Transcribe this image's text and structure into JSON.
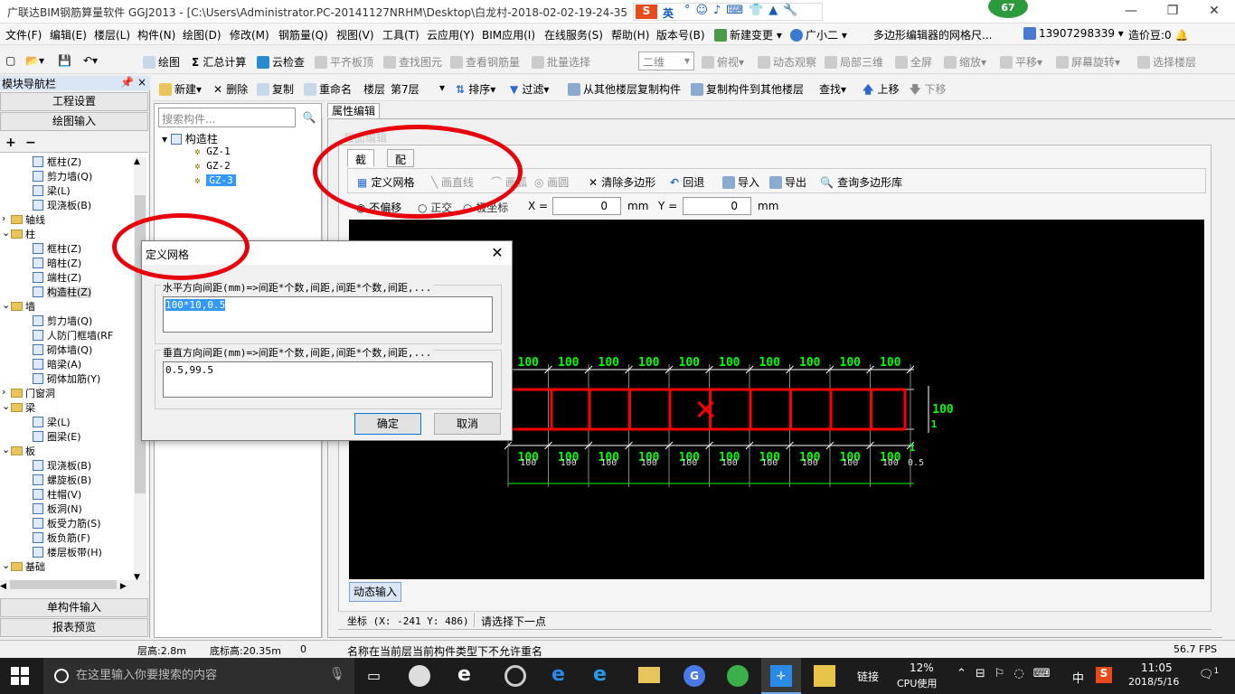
{
  "window": {
    "title": "广联达BIM钢筋算量软件 GGJ2013 - [C:\\Users\\Administrator.PC-20141127NRHM\\Desktop\\白龙村-2018-02-02-19-24-35",
    "badge": "67",
    "ime": "英"
  },
  "menu": [
    "文件(F)",
    "编辑(E)",
    "楼层(L)",
    "构件(N)",
    "绘图(D)",
    "修改(M)",
    "钢筋量(Q)",
    "视图(V)",
    "工具(T)",
    "云应用(Y)",
    "BIM应用(I)",
    "在线服务(S)",
    "帮助(H)",
    "版本号(B)",
    "新建变更",
    "广小二"
  ],
  "menu_right": {
    "hint": "多边形编辑器的网格尺...",
    "phone": "13907298339",
    "price": "造价豆:0"
  },
  "toolbar": {
    "items": [
      "绘图",
      "汇总计算",
      "云检查",
      "平齐板顶",
      "查找图元",
      "查看钢筋量",
      "批量选择"
    ],
    "view_mode": "二维",
    "right_items": [
      "俯视",
      "动态观察",
      "局部三维",
      "全屏",
      "缩放",
      "平移",
      "屏幕旋转",
      "选择楼层"
    ]
  },
  "secondary_toolbar": {
    "items": [
      "新建",
      "删除",
      "复制",
      "重命名",
      "楼层"
    ],
    "floor": "第7层",
    "more": [
      "排序",
      "过滤",
      "从其他楼层复制构件",
      "复制构件到其他楼层",
      "查找",
      "上移",
      "下移"
    ]
  },
  "left_panel": {
    "header": "模块导航栏",
    "buttons": [
      "工程设置",
      "绘图输入"
    ],
    "tree": [
      {
        "label": "框柱(Z)",
        "indent": 3,
        "type": "leaf"
      },
      {
        "label": "剪力墙(Q)",
        "indent": 3,
        "type": "leaf"
      },
      {
        "label": "梁(L)",
        "indent": 3,
        "type": "leaf"
      },
      {
        "label": "现浇板(B)",
        "indent": 3,
        "type": "leaf"
      },
      {
        "label": "轴线",
        "indent": 1,
        "type": "folder"
      },
      {
        "label": "柱",
        "indent": 1,
        "type": "folder"
      },
      {
        "label": "框柱(Z)",
        "indent": 3,
        "type": "leaf"
      },
      {
        "label": "暗柱(Z)",
        "indent": 3,
        "type": "leaf"
      },
      {
        "label": "端柱(Z)",
        "indent": 3,
        "type": "leaf"
      },
      {
        "label": "构造柱(Z)",
        "indent": 3,
        "type": "leaf"
      },
      {
        "label": "墙",
        "indent": 1,
        "type": "folder"
      },
      {
        "label": "剪力墙(Q)",
        "indent": 3,
        "type": "leaf"
      },
      {
        "label": "人防门框墙(RF",
        "indent": 3,
        "type": "leaf"
      },
      {
        "label": "砌体墙(Q)",
        "indent": 3,
        "type": "leaf"
      },
      {
        "label": "暗梁(A)",
        "indent": 3,
        "type": "leaf"
      },
      {
        "label": "砌体加筋(Y)",
        "indent": 3,
        "type": "leaf"
      },
      {
        "label": "门窗洞",
        "indent": 1,
        "type": "folder"
      },
      {
        "label": "梁",
        "indent": 1,
        "type": "folder"
      },
      {
        "label": "梁(L)",
        "indent": 3,
        "type": "leaf"
      },
      {
        "label": "圈梁(E)",
        "indent": 3,
        "type": "leaf"
      },
      {
        "label": "板",
        "indent": 1,
        "type": "folder"
      },
      {
        "label": "现浇板(B)",
        "indent": 3,
        "type": "leaf"
      },
      {
        "label": "螺旋板(B)",
        "indent": 3,
        "type": "leaf"
      },
      {
        "label": "柱帽(V)",
        "indent": 3,
        "type": "leaf"
      },
      {
        "label": "板洞(N)",
        "indent": 3,
        "type": "leaf"
      },
      {
        "label": "板受力筋(S)",
        "indent": 3,
        "type": "leaf"
      },
      {
        "label": "板负筋(F)",
        "indent": 3,
        "type": "leaf"
      },
      {
        "label": "楼层板带(H)",
        "indent": 3,
        "type": "leaf"
      },
      {
        "label": "基础",
        "indent": 1,
        "type": "folder"
      }
    ],
    "bottom_buttons": [
      "单构件输入",
      "报表预览"
    ]
  },
  "component_list": {
    "search_placeholder": "搜索构件...",
    "root": "构造柱",
    "items": [
      "GZ-1",
      "GZ-2",
      "GZ-3"
    ],
    "selected": "GZ-3"
  },
  "editor": {
    "prop_tab": "属性编辑",
    "faded_title": "截面编辑",
    "tabs": [
      "截面",
      "配筋"
    ],
    "tools": [
      "定义网格",
      "画直线",
      "画弧",
      "画圆",
      "清除多边形",
      "回退",
      "导入",
      "导出",
      "查询多边形库"
    ],
    "coord": {
      "options": [
        "不偏移",
        "正交",
        "极坐标"
      ],
      "x_label": "X =",
      "x_value": "0",
      "y_label": "Y =",
      "y_value": "0",
      "unit": "mm"
    },
    "dynamic_input": "动态输入",
    "coord_text": "坐标 (X: -241 Y: 486)",
    "prompt": "请选择下一点"
  },
  "canvas": {
    "top_dims": [
      "100",
      "100",
      "100",
      "100",
      "100",
      "100",
      "100",
      "100",
      "100",
      "100"
    ],
    "bottom_dims_green": [
      "100",
      "100",
      "100",
      "100",
      "100",
      "100",
      "100",
      "100",
      "100",
      "100"
    ],
    "bottom_dims_white": [
      "100",
      "100",
      "100",
      "100",
      "100",
      "100",
      "100",
      "100",
      "100",
      "100",
      "0.5"
    ],
    "right_dim": "100",
    "right_sub": "1",
    "bottom_sub": "1"
  },
  "dialog": {
    "title": "定义网格",
    "h_label": "水平方向间距(mm)=>间距*个数,间距,间距*个数,间距,...",
    "h_value": "100*10,0.5",
    "v_label": "垂直方向间距(mm)=>间距*个数,间距,间距*个数,间距,...",
    "v_value": "0.5,99.5",
    "ok": "确定",
    "cancel": "取消"
  },
  "status": {
    "floor_height": "层高:2.8m",
    "base_height": "底标高:20.35m",
    "zero": "0",
    "message": "名称在当前层当前构件类型下不允许重名",
    "fps": "56.7 FPS"
  },
  "taskbar": {
    "search": "在这里输入你要搜索的内容",
    "link": "链接",
    "cpu": "12%",
    "cpu_label": "CPU使用",
    "ime": "中",
    "time": "11:05",
    "date": "2018/5/16",
    "notif": "1"
  },
  "colors": {
    "accent": "#0078d7",
    "highlight_ring": "#e8000b",
    "dim_green": "#00ff00",
    "shape_red": "#ff0000"
  }
}
